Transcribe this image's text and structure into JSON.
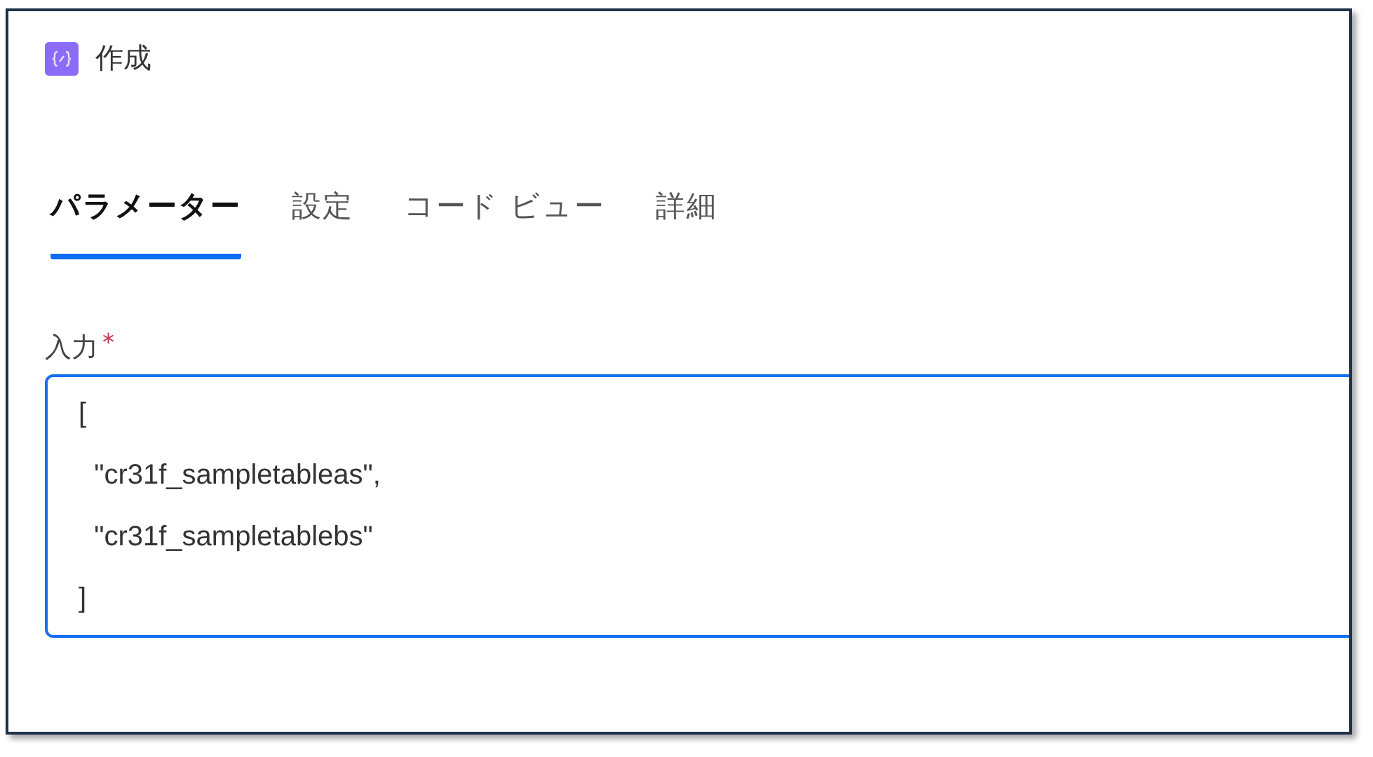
{
  "header": {
    "title": "作成"
  },
  "tabs": [
    {
      "label": "パラメーター",
      "selected": true
    },
    {
      "label": "設定",
      "selected": false
    },
    {
      "label": "コード ビュー",
      "selected": false
    },
    {
      "label": "詳細",
      "selected": false
    }
  ],
  "input": {
    "label": "入力",
    "required_mark": "*",
    "focused": true,
    "lines": [
      "[",
      "  \"cr31f_sampletableas\",",
      "  \"cr31f_sampletablebs\"",
      "]"
    ]
  }
}
